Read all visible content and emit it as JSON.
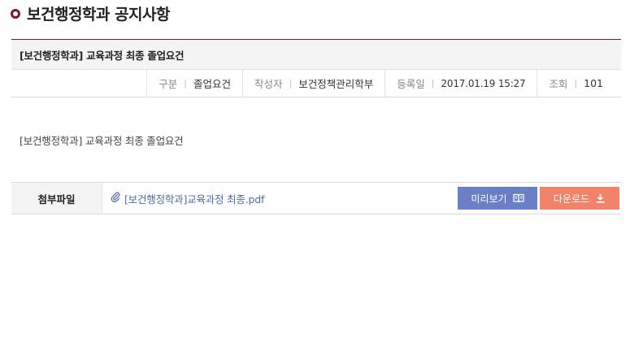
{
  "page": {
    "title": "보건행정학과 공지사항"
  },
  "post": {
    "subject": "[보건행정학과] 교육과정 최종 졸업요건",
    "meta": {
      "category_label": "구분",
      "category_value": "졸업요건",
      "author_label": "작성자",
      "author_value": "보건정책관리학부",
      "date_label": "등록일",
      "date_value": "2017.01.19 15:27",
      "views_label": "조회",
      "views_value": "101",
      "separator": "|"
    },
    "body_text": "[보건행정학과] 교육과정 최종 졸업요건"
  },
  "attachments": {
    "header": "첨부파일",
    "file_name": "[보건행정학과]교육과정 최종.pdf",
    "preview_label": "미리보기",
    "download_label": "다운로드",
    "icons": {
      "clip": "paperclip-icon",
      "preview": "book-icon",
      "download": "download-icon"
    },
    "colors": {
      "preview": "#6a7fc6",
      "download": "#f0836a",
      "accent": "#7a1733"
    }
  }
}
